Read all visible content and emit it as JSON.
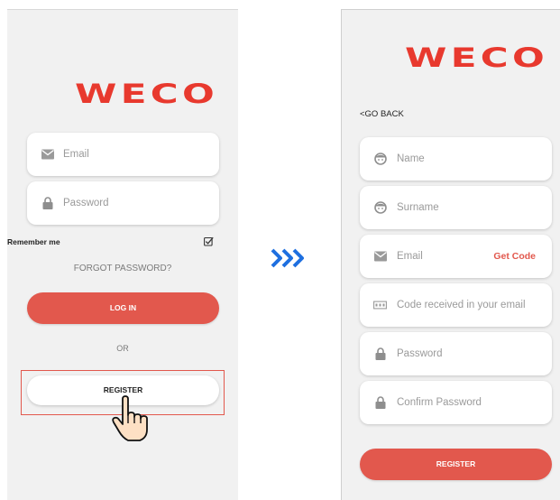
{
  "login_screen": {
    "logo": "WECO",
    "email_placeholder": "Email",
    "password_placeholder": "Password",
    "remember_me": "Remember me",
    "forgot_password": "FORGOT PASSWORD?",
    "login_button": "LOG IN",
    "or_text": "OR",
    "register_button": "REGISTER"
  },
  "arrow_icon": "triple-chevron-right",
  "register_screen": {
    "logo": "WECO",
    "go_back": "<GO BACK",
    "name_placeholder": "Name",
    "surname_placeholder": "Surname",
    "email_placeholder": "Email",
    "get_code": "Get Code",
    "code_placeholder": "Code received in your email",
    "password_placeholder": "Password",
    "confirm_password_placeholder": "Confirm Password",
    "register_button": "REGISTER"
  },
  "colors": {
    "brand_red": "#e8392e",
    "button_red": "#e2584d",
    "arrow_blue": "#1e6fe0",
    "highlight_box": "#e2584d"
  }
}
